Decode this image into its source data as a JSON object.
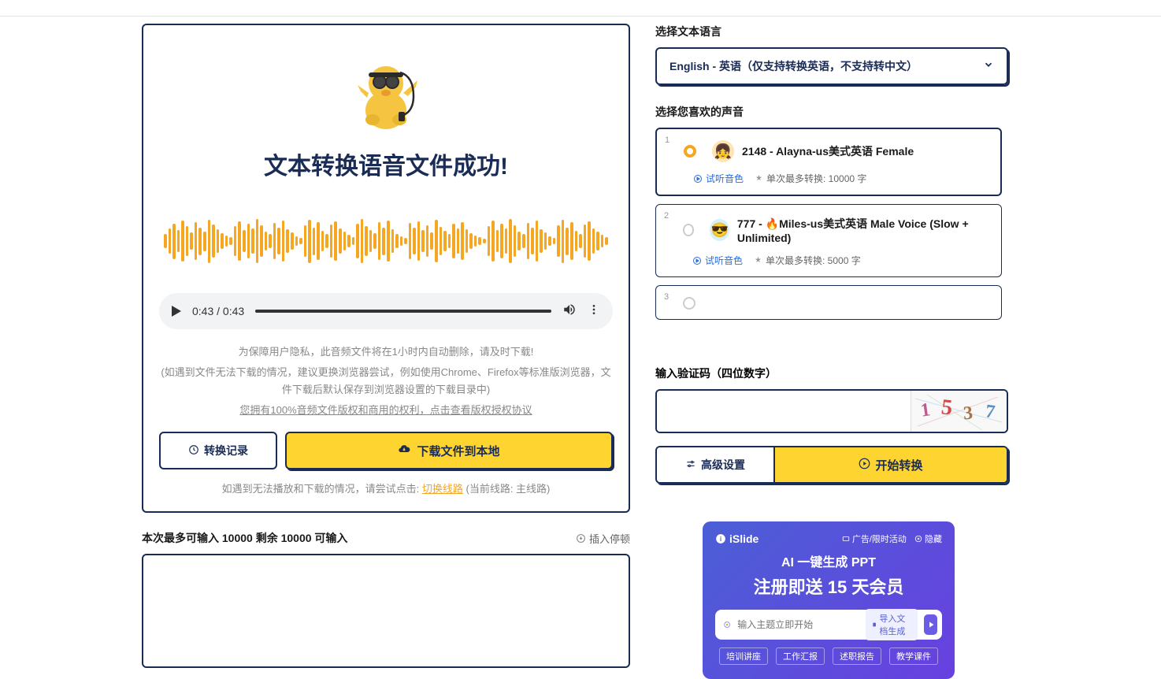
{
  "result": {
    "title": "文本转换语音文件成功!",
    "audio_time": "0:43 / 0:43",
    "notice1": "为保障用户隐私，此音频文件将在1小时内自动删除，请及时下载!",
    "notice2": "(如遇到文件无法下载的情况，建议更换浏览器尝试，例如使用Chrome、Firefox等标准版浏览器，文件下载后默认保存到浏览器设置的下载目录中)",
    "notice3": "您拥有100%音频文件版权和商用的权利，点击查看版权授权协议",
    "history_btn": "转换记录",
    "download_btn": "下载文件到本地",
    "route_text": "如遇到无法播放和下载的情况，请尝试点击: ",
    "route_link": "切换线路",
    "route_suffix": " (当前线路: 主线路)"
  },
  "input_info": {
    "text": "本次最多可输入 10000 剩余 10000 可输入",
    "insert_pause": "插入停顿"
  },
  "lang": {
    "label": "选择文本语言",
    "selected": "English - 英语（仅支持转换英语，不支持转中文）"
  },
  "voice": {
    "label": "选择您喜欢的声音",
    "items": [
      {
        "num": "1",
        "name": "2148 - Alayna-us美式英语 Female",
        "preview": "试听音色",
        "limit": "单次最多转换: 10000 字",
        "selected": true
      },
      {
        "num": "2",
        "name": "777 - 🔥Miles-us美式英语 Male Voice (Slow + Unlimited)",
        "preview": "试听音色",
        "limit": "单次最多转换: 5000 字",
        "selected": false
      },
      {
        "num": "3",
        "name": "",
        "preview": "",
        "limit": "",
        "selected": false
      }
    ]
  },
  "captcha": {
    "label": "输入验证码（四位数字）",
    "digits": "1537"
  },
  "actions": {
    "advanced": "高级设置",
    "start": "开始转换"
  },
  "ad": {
    "brand": "iSlide",
    "tag": "广告/限时活动",
    "hide": "隐藏",
    "title": "AI 一键生成 PPT",
    "subtitle": "注册即送 15 天会员",
    "placeholder": "输入主题立即开始",
    "import": "导入文档生成",
    "tabs": [
      "培训讲座",
      "工作汇报",
      "述职报告",
      "教学课件"
    ]
  }
}
